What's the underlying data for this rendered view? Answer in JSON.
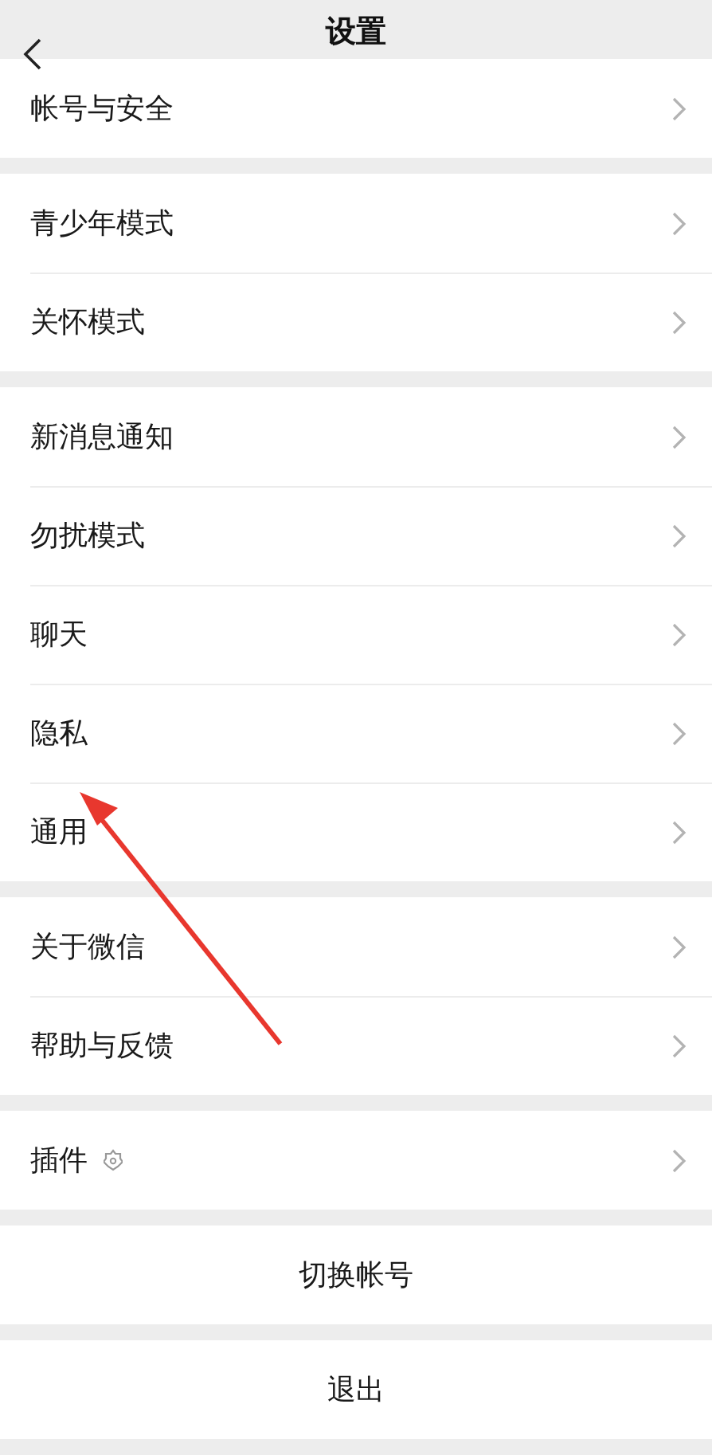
{
  "header": {
    "title": "设置"
  },
  "groups": [
    {
      "items": [
        {
          "label": "帐号与安全",
          "kind": "plain"
        }
      ]
    },
    {
      "items": [
        {
          "label": "青少年模式",
          "kind": "plain"
        },
        {
          "label": "关怀模式",
          "kind": "plain"
        }
      ]
    },
    {
      "items": [
        {
          "label": "新消息通知",
          "kind": "plain"
        },
        {
          "label": "勿扰模式",
          "kind": "plain"
        },
        {
          "label": "聊天",
          "kind": "plain"
        },
        {
          "label": "隐私",
          "kind": "plain"
        },
        {
          "label": "通用",
          "kind": "plain"
        }
      ]
    },
    {
      "items": [
        {
          "label": "关于微信",
          "kind": "plain"
        },
        {
          "label": "帮助与反馈",
          "kind": "plain"
        }
      ]
    },
    {
      "items": [
        {
          "label": "插件",
          "kind": "badged"
        }
      ]
    }
  ],
  "buttons": [
    "切换帐号",
    "退出"
  ]
}
